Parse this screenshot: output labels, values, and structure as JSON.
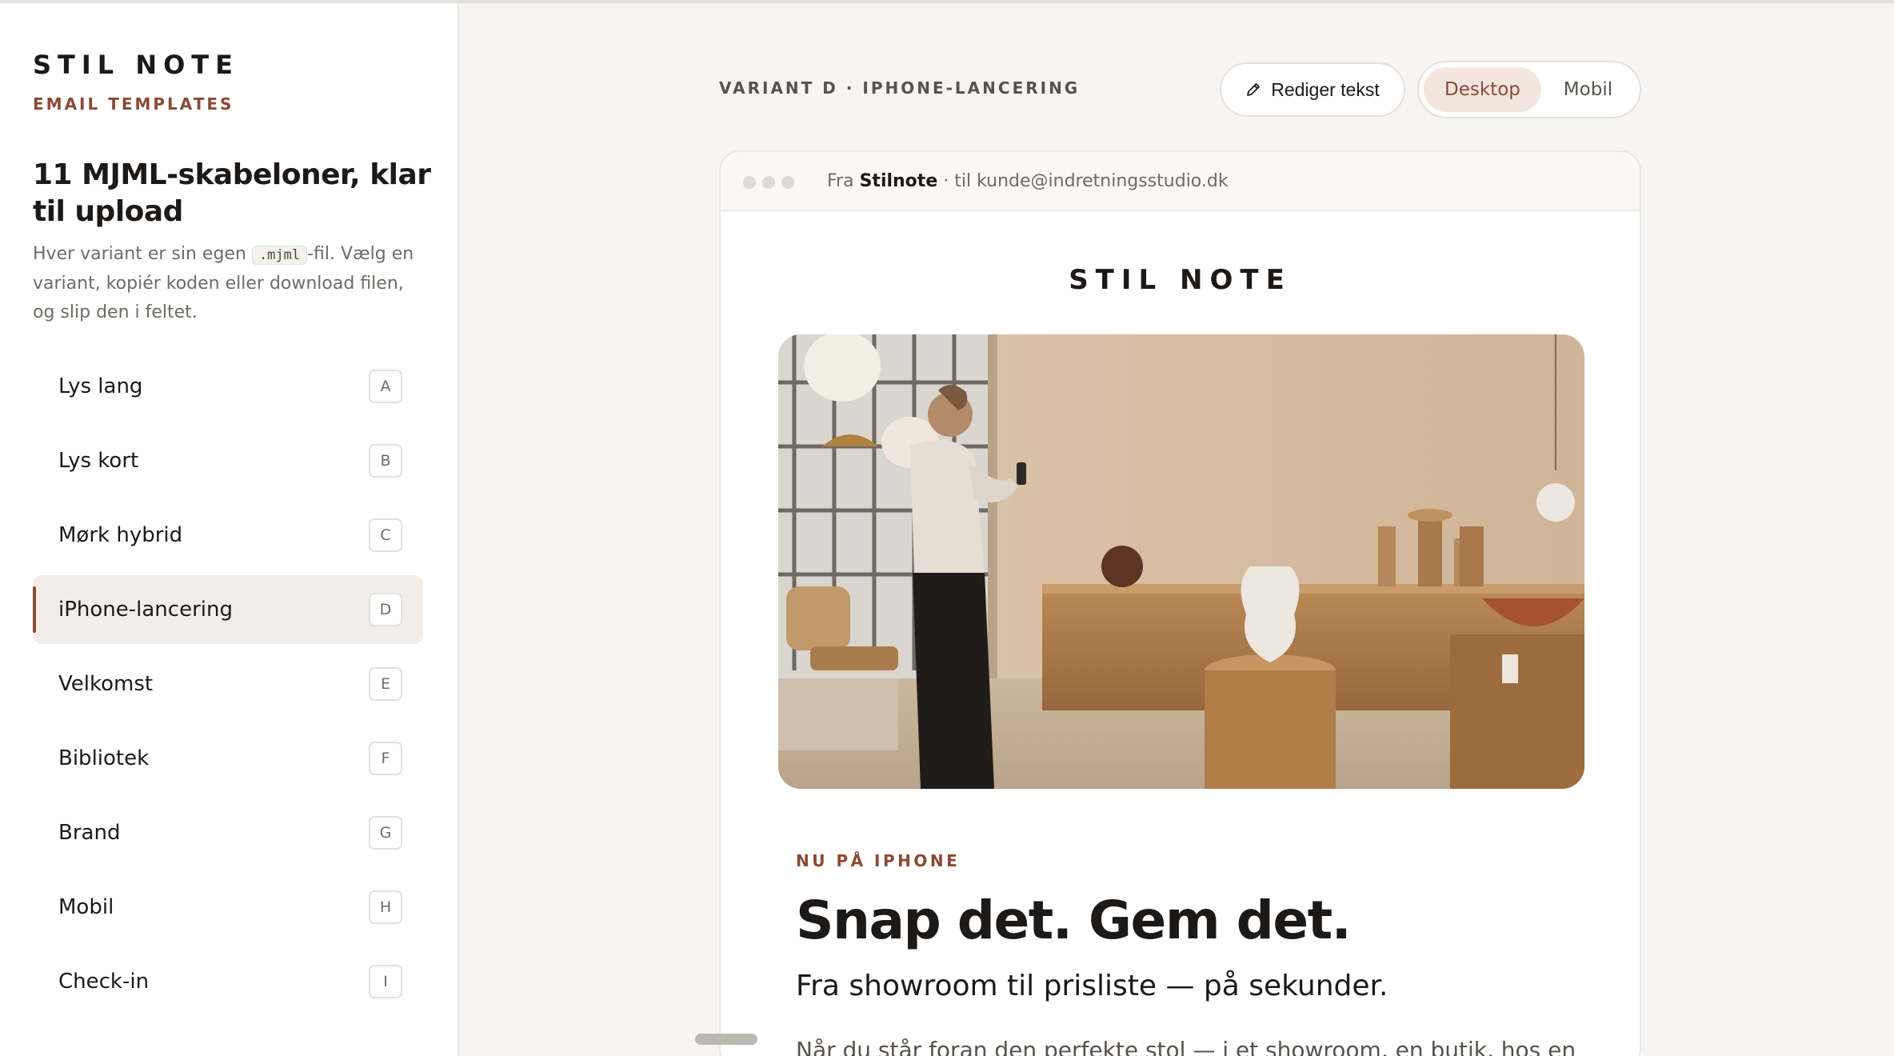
{
  "sidebar": {
    "brand": "STIL NOTE",
    "brand_sub": "EMAIL TEMPLATES",
    "heading": "11 MJML-skabeloner, klar til upload",
    "desc_before": "Hver variant er sin egen ",
    "desc_code": ".mjml",
    "desc_after": "-fil. Vælg en variant, kopiér koden eller download filen, og slip den i feltet.",
    "variants": [
      {
        "label": "Lys lang",
        "key": "A"
      },
      {
        "label": "Lys kort",
        "key": "B"
      },
      {
        "label": "Mørk hybrid",
        "key": "C"
      },
      {
        "label": "iPhone-lancering",
        "key": "D"
      },
      {
        "label": "Velkomst",
        "key": "E"
      },
      {
        "label": "Bibliotek",
        "key": "F"
      },
      {
        "label": "Brand",
        "key": "G"
      },
      {
        "label": "Mobil",
        "key": "H"
      },
      {
        "label": "Check-in",
        "key": "I"
      }
    ],
    "active_index": 3
  },
  "header": {
    "variant_title": "VARIANT D · IPHONE-LANCERING",
    "edit_label": "Rediger tekst",
    "edit_icon": "pencil-icon",
    "toggle": {
      "desktop": "Desktop",
      "mobile": "Mobil",
      "selected": "Desktop"
    }
  },
  "preview": {
    "from_prefix": "Fra ",
    "from_name": "Stilnote",
    "from_suffix": " · til kunde@indretningsstudio.dk",
    "email_brand": "STIL NOTE",
    "eyebrow": "NU PÅ IPHONE",
    "headline": "Snap det. Gem det.",
    "subhead": "Fra showroom til prisliste — på sekunder.",
    "body": "Når du står foran den perfekte stol — i et showroom, en butik, hos en"
  },
  "colors": {
    "accent": "#8a4a35",
    "accent_bg": "#f3ece7",
    "background": "#f6f5f3"
  }
}
